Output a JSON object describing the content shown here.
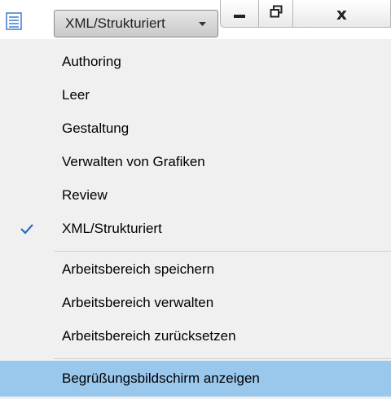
{
  "toolbar": {
    "workspace_label": "XML/Strukturiert",
    "icons": {
      "panel": "panel-layout-icon",
      "caret": "chevron-down-icon",
      "minimize": "minimize-icon",
      "restore": "restore-icon",
      "close": "close-icon"
    },
    "close_glyph": "x"
  },
  "menu": {
    "items": [
      {
        "label": "Authoring"
      },
      {
        "label": "Leer"
      },
      {
        "label": "Gestaltung"
      },
      {
        "label": "Verwalten von Grafiken"
      },
      {
        "label": "Review"
      },
      {
        "label": "XML/Strukturiert",
        "checked": true
      },
      {
        "label": "Arbeitsbereich speichern"
      },
      {
        "label": "Arbeitsbereich verwalten"
      },
      {
        "label": "Arbeitsbereich zurücksetzen"
      },
      {
        "label": "Begrüßungsbildschirm anzeigen",
        "highlighted": true
      }
    ]
  },
  "colors": {
    "menu_background": "#f0f0f0",
    "highlight": "#9ac7ec",
    "check_color": "#2a6ebb"
  }
}
